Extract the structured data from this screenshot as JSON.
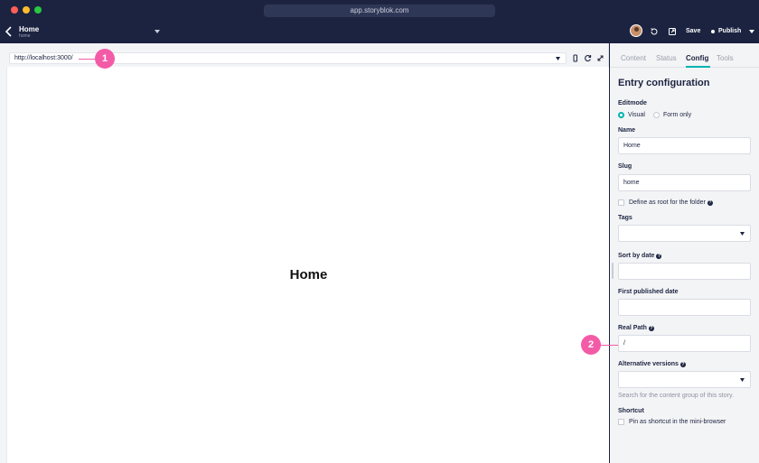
{
  "browser": {
    "url": "app.storyblok.com"
  },
  "header": {
    "story_title": "Home",
    "story_slug": "home",
    "save_label": "Save",
    "publish_label": "Publish"
  },
  "preview": {
    "address": "http://localhost:3000/",
    "page_heading": "Home"
  },
  "callouts": {
    "one": "1",
    "two": "2"
  },
  "panel": {
    "tabs": [
      {
        "label": "Content"
      },
      {
        "label": "Status"
      },
      {
        "label": "Config"
      },
      {
        "label": "Tools"
      }
    ],
    "active_tab": "Config",
    "title": "Entry configuration",
    "editmode": {
      "label": "Editmode",
      "options": [
        "Visual",
        "Form only"
      ],
      "selected": "Visual"
    },
    "name": {
      "label": "Name",
      "value": "Home"
    },
    "slug": {
      "label": "Slug",
      "value": "home"
    },
    "root_folder": {
      "label": "Define as root for the folder",
      "checked": false
    },
    "tags": {
      "label": "Tags",
      "value": ""
    },
    "sort_by_date": {
      "label": "Sort by date",
      "value": ""
    },
    "first_published": {
      "label": "First published date",
      "value": ""
    },
    "real_path": {
      "label": "Real Path",
      "value": "/"
    },
    "alt_versions": {
      "label": "Alternative versions",
      "value": "",
      "hint": "Search for the content group of this story."
    },
    "shortcut": {
      "label": "Shortcut",
      "option": "Pin as shortcut in the mini-browser",
      "checked": false
    }
  },
  "colors": {
    "accent": "#00b3b0",
    "callout": "#f35ba7",
    "navy": "#1b2340"
  }
}
